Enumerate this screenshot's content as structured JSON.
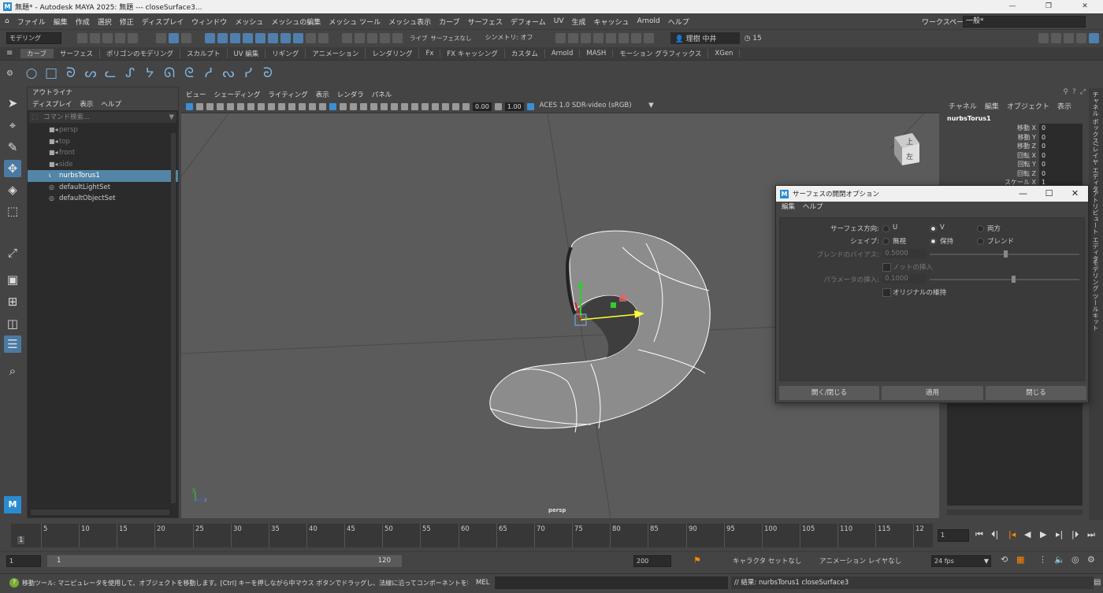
{
  "window": {
    "title": "無題* - Autodesk MAYA 2025: 無題   ---   closeSurface3...",
    "controls": [
      "—",
      "❐",
      "✕"
    ]
  },
  "menubar": [
    "ファイル",
    "編集",
    "作成",
    "選択",
    "修正",
    "ディスプレイ",
    "ウィンドウ",
    "メッシュ",
    "メッシュの編集",
    "メッシュ ツール",
    "メッシュ表示",
    "カーブ",
    "サーフェス",
    "デフォーム",
    "UV",
    "生成",
    "キャッシュ",
    "Arnold",
    "ヘルプ"
  ],
  "workspace": {
    "label": "ワークスペース :",
    "value": "一般*"
  },
  "statusline": {
    "mode": "モデリング",
    "live": "ライブ",
    "live_value": "サーフェスなし",
    "symmetry": "シンメトリ: オフ",
    "user": "理樹 中井",
    "credits": "15"
  },
  "shelf": {
    "tabs": [
      "カーブ",
      "サーフェス",
      "ポリゴンのモデリング",
      "スカルプト",
      "UV 編集",
      "リギング",
      "アニメーション",
      "レンダリング",
      "Fx",
      "FX キャッシング",
      "カスタム",
      "Arnold",
      "MASH",
      "モーション グラフィックス",
      "XGen"
    ],
    "icons": [
      "○",
      "□",
      "ᘐ",
      "ᔕ",
      "ᓚ",
      "ᔑ",
      "ᔭ",
      "ᘏ",
      "ᘓ",
      "ᓱ",
      "ᔓ",
      "ᓯ",
      "ᘒ"
    ]
  },
  "outliner": {
    "title": "アウトライナ",
    "menu": [
      "ディスプレイ",
      "表示",
      "ヘルプ"
    ],
    "search_placeholder": "コマンド検索...",
    "items": [
      {
        "label": "persp",
        "state": "dim",
        "icon": "■◂"
      },
      {
        "label": "top",
        "state": "dim",
        "icon": "■◂"
      },
      {
        "label": "front",
        "state": "dim",
        "icon": "■◂"
      },
      {
        "label": "side",
        "state": "dim",
        "icon": "■◂"
      },
      {
        "label": "nurbsTorus1",
        "state": "sel",
        "icon": "ɩ"
      },
      {
        "label": "defaultLightSet",
        "state": "",
        "icon": "◎"
      },
      {
        "label": "defaultObjectSet",
        "state": "",
        "icon": "◎"
      }
    ]
  },
  "viewport": {
    "menu": [
      "ビュー",
      "シェーディング",
      "ライティング",
      "表示",
      "レンダラ",
      "パネル"
    ],
    "near": "0.00",
    "far": "1.00",
    "colorspace": "ACES 1.0 SDR-video (sRGB)",
    "camera_label": "persp",
    "cube": {
      "top": "上",
      "front": "左"
    },
    "axis_y": "y",
    "axis_z": "z"
  },
  "channelbox": {
    "menu": [
      "チャネル",
      "編集",
      "オブジェクト",
      "表示"
    ],
    "object": "nurbsTorus1",
    "attrs": [
      {
        "label": "移動 X",
        "value": "0"
      },
      {
        "label": "移動 Y",
        "value": "0"
      },
      {
        "label": "移動 Z",
        "value": "0"
      },
      {
        "label": "回転 X",
        "value": "0"
      },
      {
        "label": "回転 Y",
        "value": "0"
      },
      {
        "label": "回転 Z",
        "value": "0"
      },
      {
        "label": "スケール X",
        "value": "1"
      }
    ]
  },
  "side_tabs": [
    "チャネル ボックス/レイヤ エディタ",
    "アトリビュート エディタ",
    "モデリング ツールキット"
  ],
  "dialog": {
    "title": "サーフェスの開閉オプション",
    "menu": [
      "編集",
      "ヘルプ"
    ],
    "direction": {
      "label": "サーフェス方向:",
      "options": [
        "U",
        "V",
        "両方"
      ],
      "selected": "V"
    },
    "shape": {
      "label": "シェイプ:",
      "options": [
        "無視",
        "保持",
        "ブレンド"
      ],
      "selected": "保持"
    },
    "blend_bias": {
      "label": "ブレンドのバイアス:",
      "value": "0.5000"
    },
    "insert_knot": {
      "label": "ノットの挿入"
    },
    "insert_param": {
      "label": "パラメータの挿入:",
      "value": "0.1000"
    },
    "keep_original": {
      "label": "オリジナルの維持"
    },
    "buttons": [
      "開く/閉じる",
      "適用",
      "閉じる"
    ]
  },
  "timeline": {
    "ticks": [
      "5",
      "10",
      "15",
      "20",
      "25",
      "30",
      "35",
      "40",
      "45",
      "50",
      "55",
      "60",
      "65",
      "70",
      "75",
      "80",
      "85",
      "90",
      "95",
      "100",
      "105",
      "110",
      "115",
      "12"
    ],
    "start_label": "1",
    "current_frame": "1"
  },
  "range": {
    "start": "1",
    "inner_start": "1",
    "inner_end": "120",
    "end": "200",
    "character_set": "キャラクタ セットなし",
    "anim_layer": "アニメーション レイヤなし",
    "fps": "24 fps"
  },
  "cmdline": {
    "help": "移動ツール: マニピュレータを使用して、オブジェクトを移動します。[Ctrl] キーを押しながら中マウス ボタンでドラッグし、法線に沿ってコンポーネントを移動します。[Shift] キーを押しながらマニピ",
    "lang": "MEL",
    "result": "// 結果: nurbsTorus1 closeSurface3"
  },
  "colors": {
    "accent": "#5285a6",
    "bg": "#444444",
    "viewport": "#5b5b5b"
  }
}
